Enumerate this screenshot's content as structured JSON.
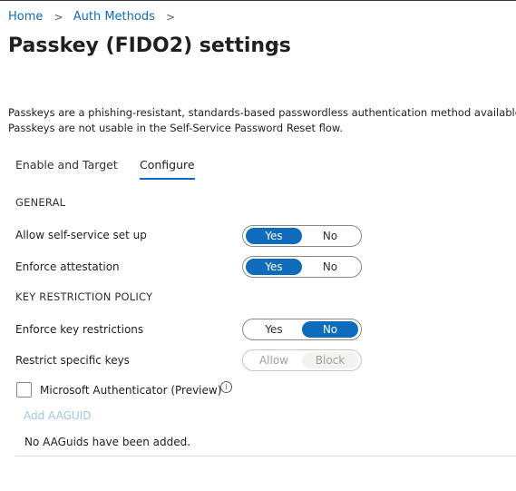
{
  "breadcrumb": {
    "items": [
      "Home",
      "Auth Methods"
    ],
    "separator": ">"
  },
  "page": {
    "title": "Passkey (FIDO2) settings",
    "more_label": "···"
  },
  "description": {
    "line1": "Passkeys are a phishing-resistant, standards-based passwordless authentication method available",
    "line2": "Passkeys are not usable in the Self-Service Password Reset flow."
  },
  "tabs": [
    {
      "label": "Enable and Target",
      "active": false
    },
    {
      "label": "Configure",
      "active": true
    }
  ],
  "general": {
    "heading": "GENERAL",
    "allow_self_service": {
      "label": "Allow self-service set up",
      "options": [
        "Yes",
        "No"
      ],
      "selected": "Yes"
    },
    "enforce_attestation": {
      "label": "Enforce attestation",
      "options": [
        "Yes",
        "No"
      ],
      "selected": "Yes"
    }
  },
  "key_restriction": {
    "heading": "KEY RESTRICTION POLICY",
    "enforce_key_restrictions": {
      "label": "Enforce key restrictions",
      "options": [
        "Yes",
        "No"
      ],
      "selected": "No"
    },
    "restrict_specific_keys": {
      "label": "Restrict specific keys",
      "options": [
        "Allow",
        "Block"
      ],
      "selected": "Block",
      "disabled": true
    },
    "microsoft_authenticator": {
      "label": "Microsoft Authenticator (Preview)",
      "checked": false,
      "info_icon": "info-icon"
    },
    "add_aaguid_label": "Add AAGUID",
    "empty_message": "No AAGuids have been added."
  },
  "colors": {
    "accent": "#0f6cbd",
    "link_disabled": "#9fc6ea"
  }
}
